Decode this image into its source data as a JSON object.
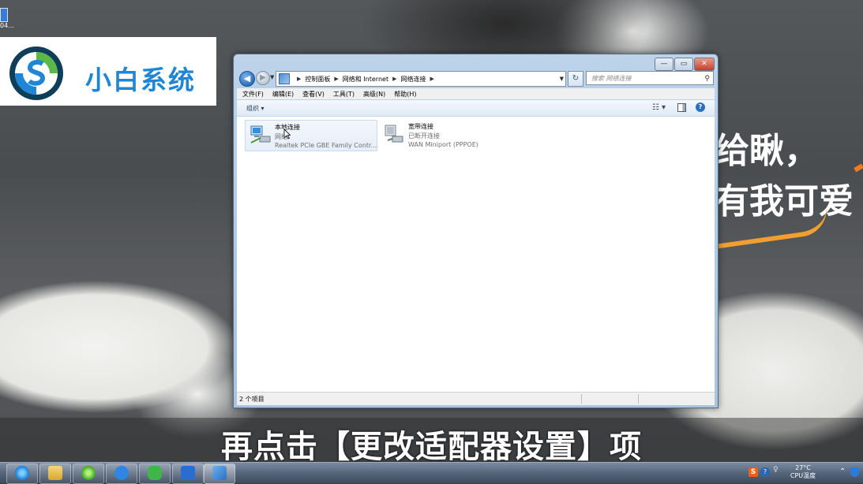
{
  "desktop": {
    "partial_icon_label": "04...",
    "logo_text": "小白系统",
    "slogan": [
      "给瞅，",
      "有我可爱"
    ]
  },
  "window": {
    "controls": {
      "minimize": "▭",
      "maximize": "▭",
      "close": "✕"
    },
    "address": {
      "crumbs": [
        "控制面板",
        "网络和 Internet",
        "网络连接"
      ],
      "search_placeholder": "搜索 网络连接"
    },
    "menu": [
      "文件(F)",
      "编辑(E)",
      "查看(V)",
      "工具(T)",
      "高级(N)",
      "帮助(H)"
    ],
    "toolbar": {
      "organize": "组织 ▾",
      "help": "?"
    },
    "items": [
      {
        "name": "本地连接",
        "status": "网络",
        "device": "Realtek PCIe GBE Family Contr..."
      },
      {
        "name": "宽带连接",
        "status": "已断开连接",
        "device": "WAN Miniport (PPPOE)"
      }
    ],
    "statusbar": {
      "count": "2 个项目"
    }
  },
  "subtitle": "再点击【更改适配器设置】项",
  "taskbar": {
    "apps": [
      "internet-explorer",
      "file-explorer",
      "360-browser",
      "feiyu",
      "wechat",
      "wps",
      "control-panel"
    ],
    "tray": {
      "temp": "27°C",
      "temp_label": "CPU温度"
    }
  }
}
